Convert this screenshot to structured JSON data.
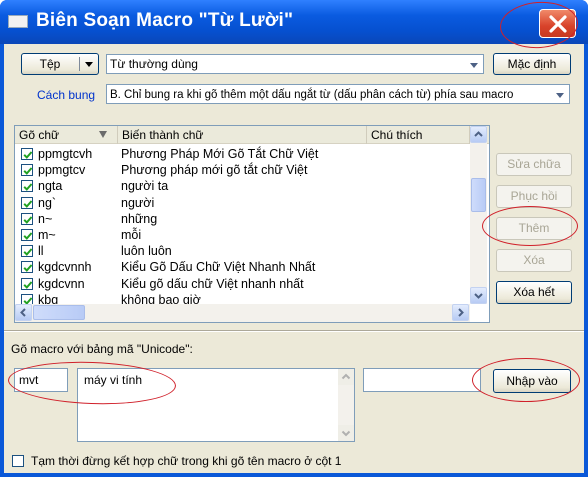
{
  "window": {
    "title": "Biên Soạn Macro \"Từ Lười\""
  },
  "toolbar": {
    "file_label": "Tệp",
    "dictionary_value": "Từ thường dùng",
    "default_label": "Mặc định"
  },
  "popup": {
    "label": "Cách bung",
    "value": "B. Chỉ bung ra khi gõ thêm một dấu ngắt từ (dấu phân cách từ) phía sau macro"
  },
  "table": {
    "columns": [
      "Gõ chữ",
      "Biến thành chữ",
      "Chú thích"
    ],
    "rows": [
      {
        "checked": true,
        "key": "ppmgtcvh",
        "value": "Phương Pháp Mới Gõ Tắt Chữ Việt"
      },
      {
        "checked": true,
        "key": "ppmgtcv",
        "value": "Phương pháp mới gõ tắt chữ Việt"
      },
      {
        "checked": true,
        "key": "ngta",
        "value": "người ta"
      },
      {
        "checked": true,
        "key": "ng`",
        "value": "người"
      },
      {
        "checked": true,
        "key": "n~",
        "value": "những"
      },
      {
        "checked": true,
        "key": "m~",
        "value": "mỗi"
      },
      {
        "checked": true,
        "key": "ll",
        "value": "luôn luôn"
      },
      {
        "checked": true,
        "key": "kgdcvnnh",
        "value": "Kiểu Gõ Dấu Chữ Việt Nhanh Nhất"
      },
      {
        "checked": true,
        "key": "kgdcvnn",
        "value": "Kiểu gõ dấu chữ Việt nhanh nhất"
      },
      {
        "checked": true,
        "key": "kbg",
        "value": "không bao giờ"
      }
    ]
  },
  "actions": {
    "edit": "Sửa chữa",
    "restore": "Phục hồi",
    "add": "Thêm",
    "delete": "Xóa",
    "delete_all": "Xóa hết"
  },
  "editor": {
    "section_label": "Gõ macro với bảng mã \"Unicode\":",
    "macro_key": "mvt",
    "macro_value": "máy vi tính",
    "comment": "",
    "import_label": "Nhập vào"
  },
  "footer": {
    "checkbox_label": "Tạm thời đừng kết hợp chữ trong khi gõ tên macro ở cột 1",
    "checked": false
  },
  "colors": {
    "title_bar": "#0a58d8",
    "dialog_bg": "#ece9d8",
    "annotation": "#d0202a",
    "popup_label": "#0033cc"
  }
}
